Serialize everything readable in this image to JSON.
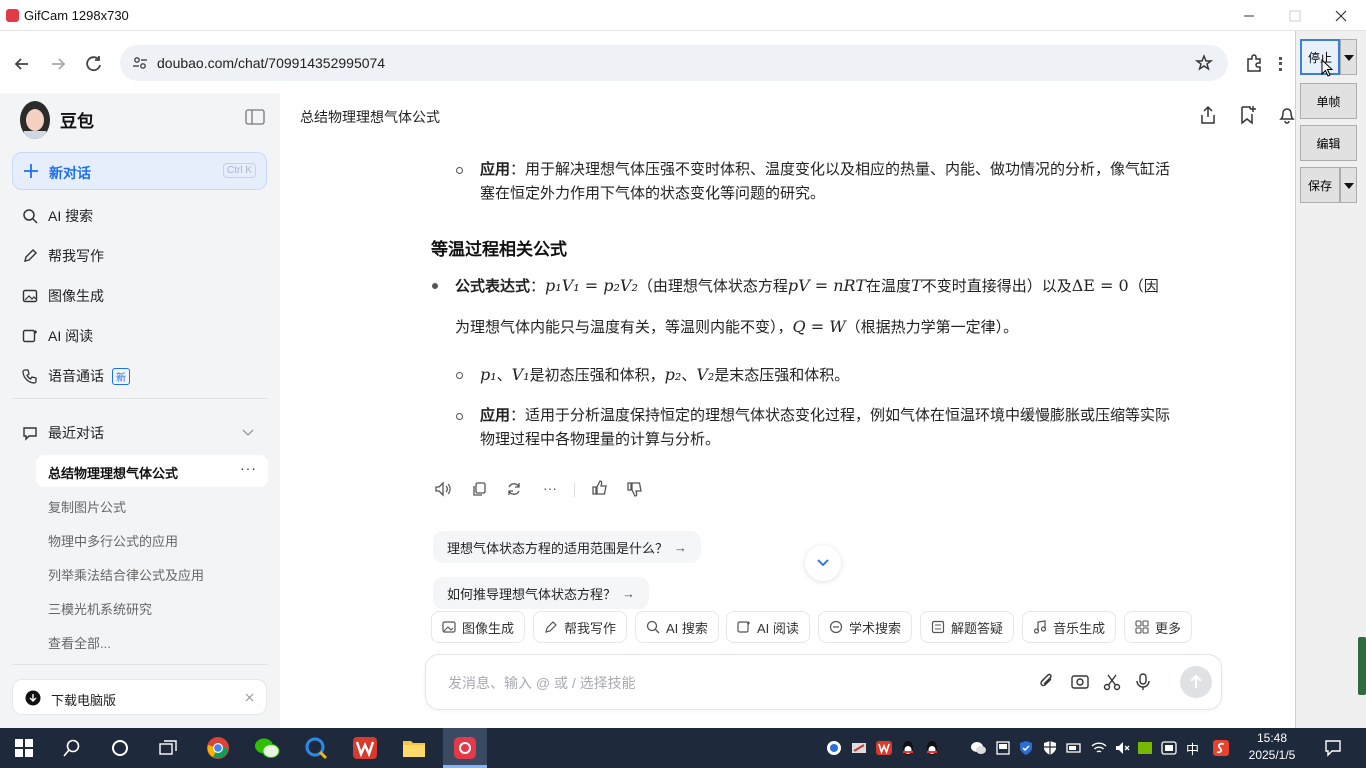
{
  "window": {
    "title": "GifCam 1298x730"
  },
  "browser": {
    "url": "doubao.com/chat/709914352995074"
  },
  "sidebar": {
    "brand": "豆包",
    "new_chat": "新对话",
    "new_chat_shortcut": "Ctrl K",
    "items": [
      {
        "label": "AI 搜索",
        "icon": "search-icon"
      },
      {
        "label": "帮我写作",
        "icon": "pen-icon"
      },
      {
        "label": "图像生成",
        "icon": "image-icon"
      },
      {
        "label": "AI 阅读",
        "icon": "book-icon"
      },
      {
        "label": "语音通话",
        "icon": "phone-icon",
        "badge": "新"
      }
    ],
    "recent_header": "最近对话",
    "active_chat": "总结物理理想气体公式",
    "recent": [
      "复制图片公式",
      "物理中多行公式的应用",
      "列举乘法结合律公式及应用",
      "三模光机系统研究",
      "查看全部..."
    ],
    "download": "下载电脑版"
  },
  "header": {
    "title": "总结物理理想气体公式"
  },
  "content": {
    "app1_label": "应用",
    "app1_text": "：用于解决理想气体压强不变时体积、温度变化以及相应的热量、内能、做功情况的分析，像气缸活",
    "app1_text2": "塞在恒定外力作用下气体的状态变化等问题的研究。",
    "section": "等温过程相关公式",
    "formula_label": "公式表达式",
    "f_colon": "：",
    "f_math1": "p₁V₁ = p₂V₂",
    "f_t1": "（由理想气体状态方程",
    "f_math2": "pV = nRT",
    "f_t2": "在温度",
    "f_math3": "T",
    "f_t3": "不变时直接得出）以及",
    "f_math4": "ΔE = 0",
    "f_t4": "（因",
    "f_line2a": "为理想气体内能只与温度有关，等温则内能不变），",
    "f_math5": "Q = W",
    "f_line2b": "（根据热力学第一定律）。",
    "var_math1": "p₁",
    "var_sep1": "、",
    "var_math2": "V₁",
    "var_t1": "是初态压强和体积，",
    "var_math3": "p₂",
    "var_sep2": "、",
    "var_math4": "V₂",
    "var_t2": "是末态压强和体积。",
    "app2_label": "应用",
    "app2_text": "：适用于分析温度保持恒定的理想气体状态变化过程，例如气体在恒温环境中缓慢膨胀或压缩等实际",
    "app2_text2": "物理过程中各物理量的计算与分析。"
  },
  "suggestions": [
    "理想气体状态方程的适用范围是什么？",
    "如何推导理想气体状态方程？"
  ],
  "skills": [
    "图像生成",
    "帮我写作",
    "AI 搜索",
    "AI 阅读",
    "学术搜索",
    "解题答疑",
    "音乐生成",
    "更多"
  ],
  "input": {
    "placeholder": "发消息、输入 @ 或 / 选择技能"
  },
  "gifcam": {
    "stop": "停止",
    "frame": "单帧",
    "edit": "编辑",
    "save": "保存"
  },
  "taskbar": {
    "time": "15:48",
    "date": "2025/1/5",
    "ime": "中"
  },
  "colors": {
    "accent": "#1d6ff2",
    "new_chat_bg": "#e6eefc",
    "taskbar": "#1e2a3c"
  }
}
